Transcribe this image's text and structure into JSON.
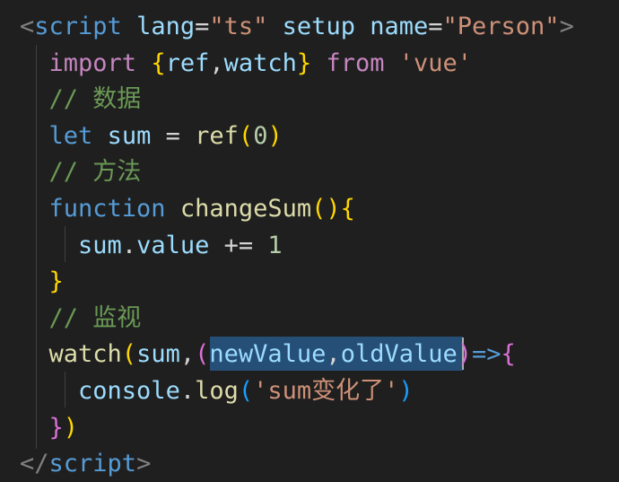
{
  "editor": {
    "lines": [
      {
        "id": "line-1",
        "tokens": [
          {
            "cls": "tag",
            "text": "<"
          },
          {
            "cls": "tagname",
            "text": "script"
          },
          {
            "cls": "plain",
            "text": " "
          },
          {
            "cls": "attr",
            "text": "lang"
          },
          {
            "cls": "op",
            "text": "="
          },
          {
            "cls": "str",
            "text": "\"ts\""
          },
          {
            "cls": "plain",
            "text": " "
          },
          {
            "cls": "attr",
            "text": "setup"
          },
          {
            "cls": "plain",
            "text": " "
          },
          {
            "cls": "attr",
            "text": "name"
          },
          {
            "cls": "op",
            "text": "="
          },
          {
            "cls": "str",
            "text": "\"Person\""
          },
          {
            "cls": "tag",
            "text": ">"
          }
        ]
      },
      {
        "id": "line-2",
        "tokens": [
          {
            "cls": "plain",
            "text": "  "
          },
          {
            "cls": "kw-import",
            "text": "import"
          },
          {
            "cls": "plain",
            "text": " "
          },
          {
            "cls": "brace1",
            "text": "{"
          },
          {
            "cls": "var",
            "text": "ref"
          },
          {
            "cls": "plain",
            "text": ","
          },
          {
            "cls": "var",
            "text": "watch"
          },
          {
            "cls": "brace1",
            "text": "}"
          },
          {
            "cls": "plain",
            "text": " "
          },
          {
            "cls": "kw-import",
            "text": "from"
          },
          {
            "cls": "plain",
            "text": " "
          },
          {
            "cls": "str",
            "text": "'vue'"
          }
        ]
      },
      {
        "id": "line-3",
        "tokens": [
          {
            "cls": "plain",
            "text": "  "
          },
          {
            "cls": "comment",
            "text": "// 数据"
          }
        ]
      },
      {
        "id": "line-4",
        "tokens": [
          {
            "cls": "plain",
            "text": "  "
          },
          {
            "cls": "kw",
            "text": "let"
          },
          {
            "cls": "plain",
            "text": " "
          },
          {
            "cls": "var",
            "text": "sum"
          },
          {
            "cls": "plain",
            "text": " "
          },
          {
            "cls": "op",
            "text": "="
          },
          {
            "cls": "plain",
            "text": " "
          },
          {
            "cls": "fn",
            "text": "ref"
          },
          {
            "cls": "brace1",
            "text": "("
          },
          {
            "cls": "num",
            "text": "0"
          },
          {
            "cls": "brace1",
            "text": ")"
          }
        ]
      },
      {
        "id": "line-5",
        "tokens": [
          {
            "cls": "plain",
            "text": "  "
          },
          {
            "cls": "comment",
            "text": "// 方法"
          }
        ]
      },
      {
        "id": "line-6",
        "tokens": [
          {
            "cls": "plain",
            "text": "  "
          },
          {
            "cls": "kw",
            "text": "function"
          },
          {
            "cls": "plain",
            "text": " "
          },
          {
            "cls": "fn",
            "text": "changeSum"
          },
          {
            "cls": "brace1",
            "text": "()"
          },
          {
            "cls": "brace1",
            "text": "{"
          }
        ]
      },
      {
        "id": "line-7",
        "tokens": [
          {
            "cls": "plain",
            "text": "    "
          },
          {
            "cls": "var",
            "text": "sum"
          },
          {
            "cls": "plain",
            "text": "."
          },
          {
            "cls": "var",
            "text": "value"
          },
          {
            "cls": "plain",
            "text": " "
          },
          {
            "cls": "op",
            "text": "+="
          },
          {
            "cls": "plain",
            "text": " "
          },
          {
            "cls": "num",
            "text": "1"
          }
        ]
      },
      {
        "id": "line-8",
        "tokens": [
          {
            "cls": "plain",
            "text": "  "
          },
          {
            "cls": "brace1",
            "text": "}"
          }
        ]
      },
      {
        "id": "line-9",
        "tokens": [
          {
            "cls": "plain",
            "text": "  "
          },
          {
            "cls": "comment",
            "text": "// 监视"
          }
        ]
      },
      {
        "id": "line-10",
        "tokens": [
          {
            "cls": "plain",
            "text": "  "
          },
          {
            "cls": "fn",
            "text": "watch"
          },
          {
            "cls": "brace1",
            "text": "("
          },
          {
            "cls": "var",
            "text": "sum"
          },
          {
            "cls": "plain",
            "text": ","
          },
          {
            "cls": "brace2",
            "text": "("
          },
          {
            "cls": "var",
            "text": "newValue"
          },
          {
            "cls": "plain",
            "text": ","
          },
          {
            "cls": "var",
            "text": "oldValue"
          },
          {
            "cls": "brace2",
            "text": ")"
          },
          {
            "cls": "kw",
            "text": "=>"
          },
          {
            "cls": "brace2",
            "text": "{"
          }
        ]
      },
      {
        "id": "line-11",
        "tokens": [
          {
            "cls": "plain",
            "text": "    "
          },
          {
            "cls": "var",
            "text": "console"
          },
          {
            "cls": "plain",
            "text": "."
          },
          {
            "cls": "fn",
            "text": "log"
          },
          {
            "cls": "brace3",
            "text": "("
          },
          {
            "cls": "str",
            "text": "'sum变化了'"
          },
          {
            "cls": "brace3",
            "text": ")"
          }
        ]
      },
      {
        "id": "line-12",
        "tokens": [
          {
            "cls": "plain",
            "text": "  "
          },
          {
            "cls": "brace2",
            "text": "}"
          },
          {
            "cls": "brace1",
            "text": ")"
          }
        ]
      },
      {
        "id": "line-13",
        "tokens": [
          {
            "cls": "tag",
            "text": "</"
          },
          {
            "cls": "tagname",
            "text": "script"
          },
          {
            "cls": "tag",
            "text": ">"
          }
        ]
      }
    ]
  },
  "colors": {
    "background": "#1f1f1f",
    "selection": "#264f78",
    "indent_guide": "#404040"
  }
}
